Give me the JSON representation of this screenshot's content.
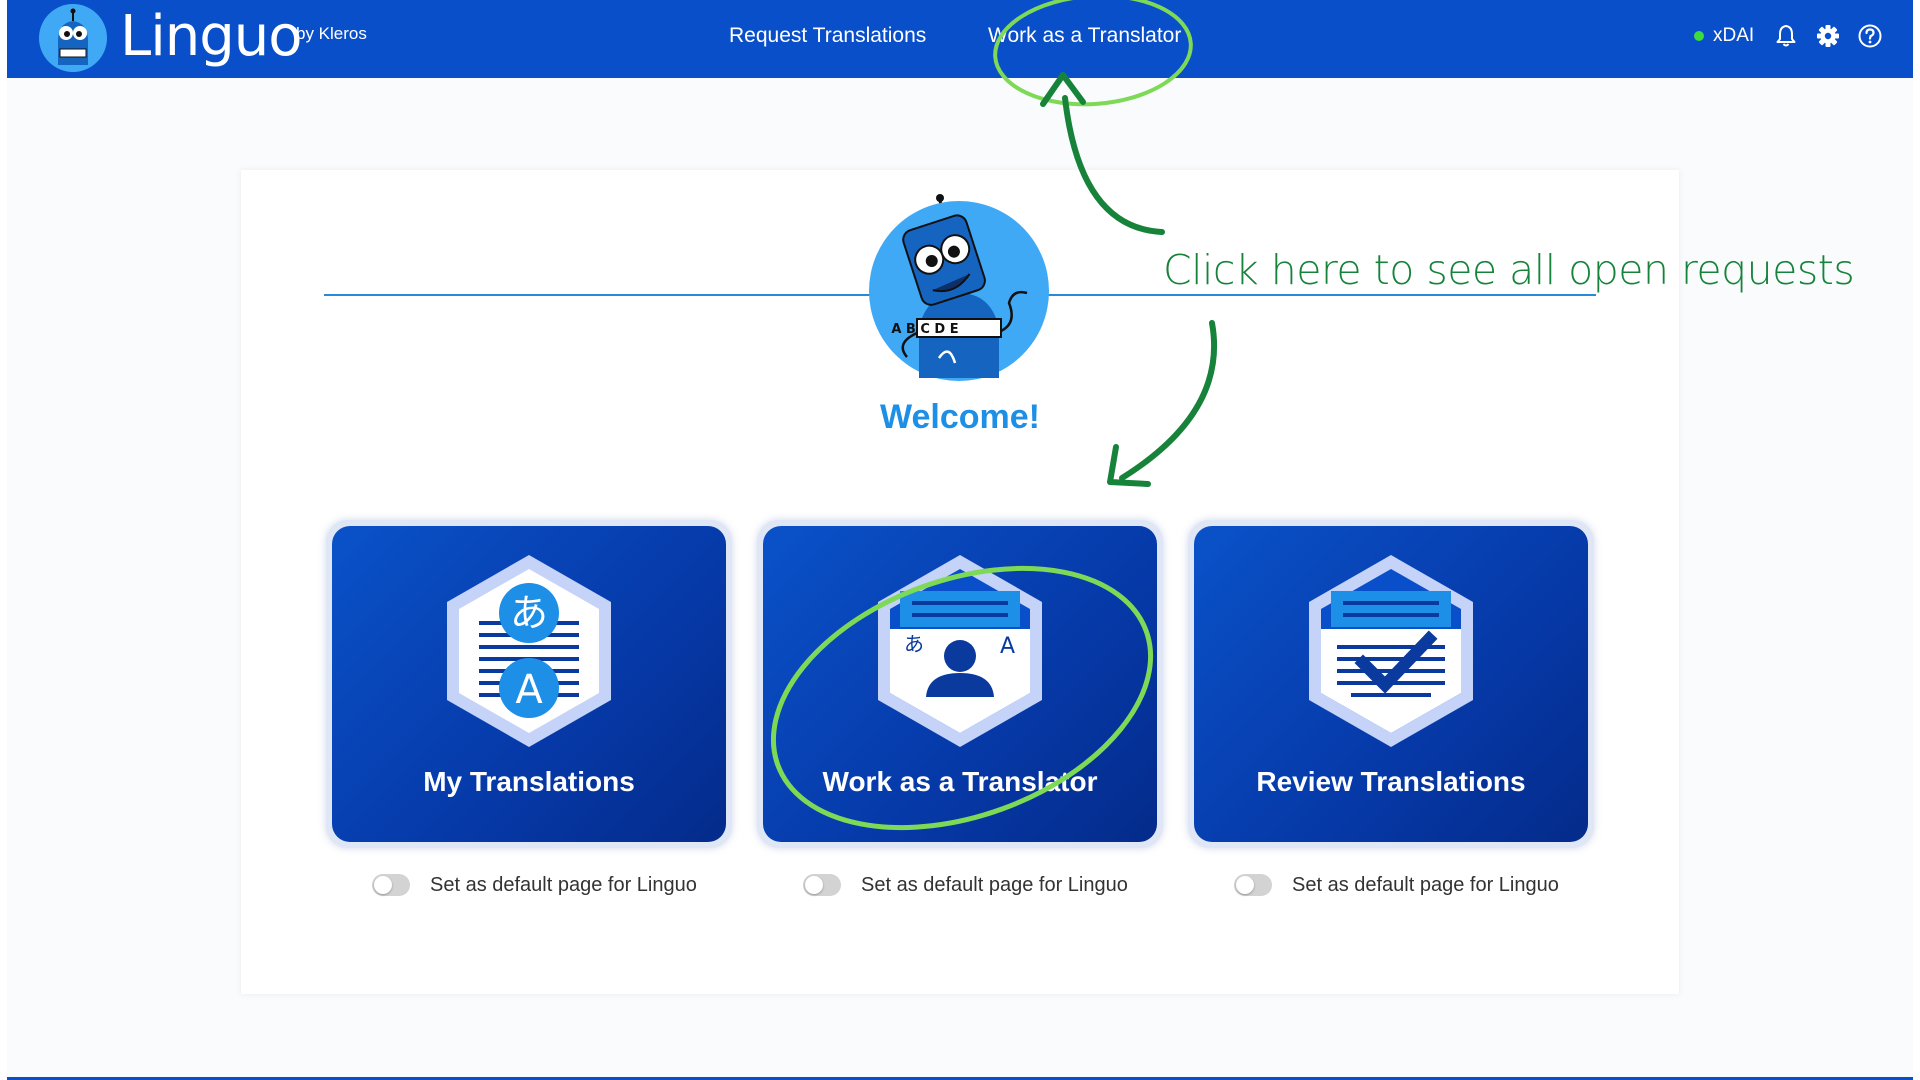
{
  "app": {
    "brand": "Linguo",
    "byline": "by Kleros"
  },
  "nav": {
    "request_translations": "Request Translations",
    "work_as_translator": "Work as a Translator"
  },
  "header": {
    "network_label": "xDAI",
    "network_status_color": "#3ddc3d",
    "icons": [
      "bell-icon",
      "gear-icon",
      "help-icon"
    ]
  },
  "hero": {
    "robot_board_letters": "ABCDE",
    "welcome": "Welcome!"
  },
  "tiles": [
    {
      "label": "My Translations",
      "icon": "translate-document-icon"
    },
    {
      "label": "Work as a Translator",
      "icon": "translator-card-icon"
    },
    {
      "label": "Review Translations",
      "icon": "review-checklist-icon"
    }
  ],
  "toggles": [
    {
      "label": "Set as default page for Linguo",
      "on": false
    },
    {
      "label": "Set as default page for Linguo",
      "on": false
    },
    {
      "label": "Set as default page for Linguo",
      "on": false
    }
  ],
  "annotation": {
    "text": "Click here  to see all open requests",
    "color": "#17833a"
  },
  "colors": {
    "header_bg": "#0a4fca",
    "accent": "#1d8fe6",
    "tile_bg": "#0639a8"
  }
}
